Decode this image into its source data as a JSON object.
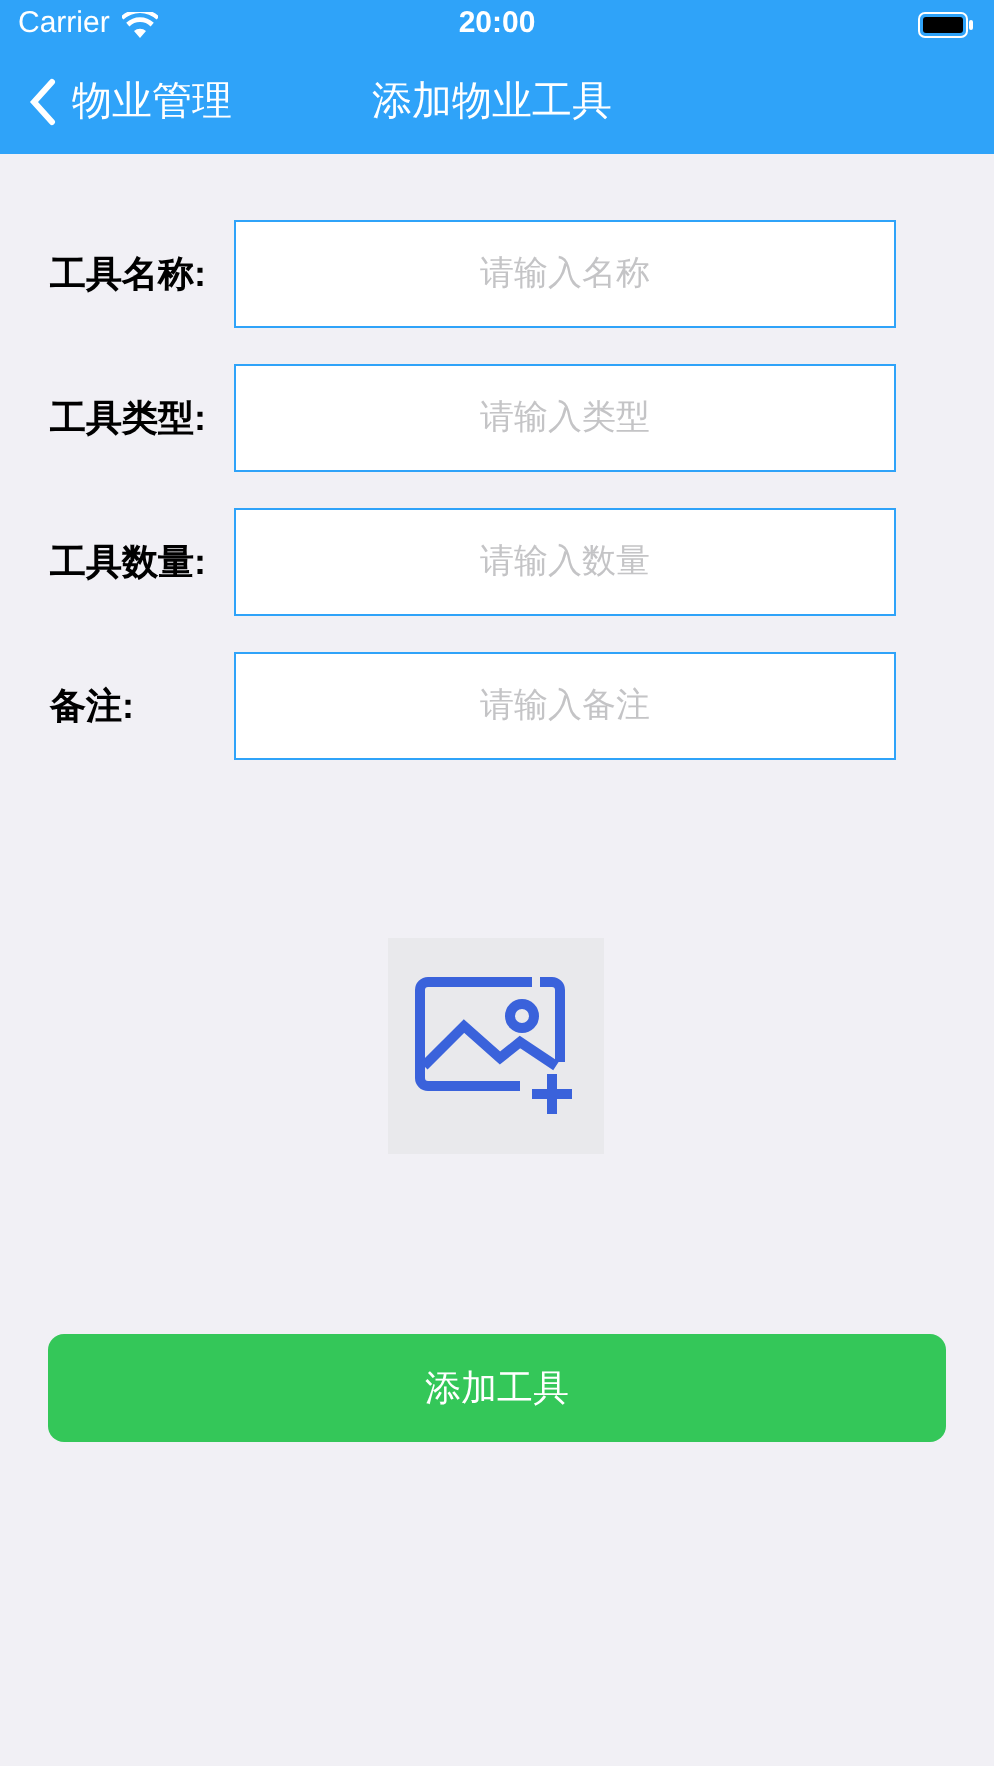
{
  "status_bar": {
    "carrier": "Carrier",
    "time": "20:00"
  },
  "nav": {
    "back_label": "物业管理",
    "title": "添加物业工具"
  },
  "fields": [
    {
      "label": "工具名称:",
      "placeholder": "请输入名称"
    },
    {
      "label": "工具类型:",
      "placeholder": "请输入类型"
    },
    {
      "label": "工具数量:",
      "placeholder": "请输入数量"
    },
    {
      "label": "备注:",
      "placeholder": "请输入备注"
    }
  ],
  "submit_button": "添加工具"
}
